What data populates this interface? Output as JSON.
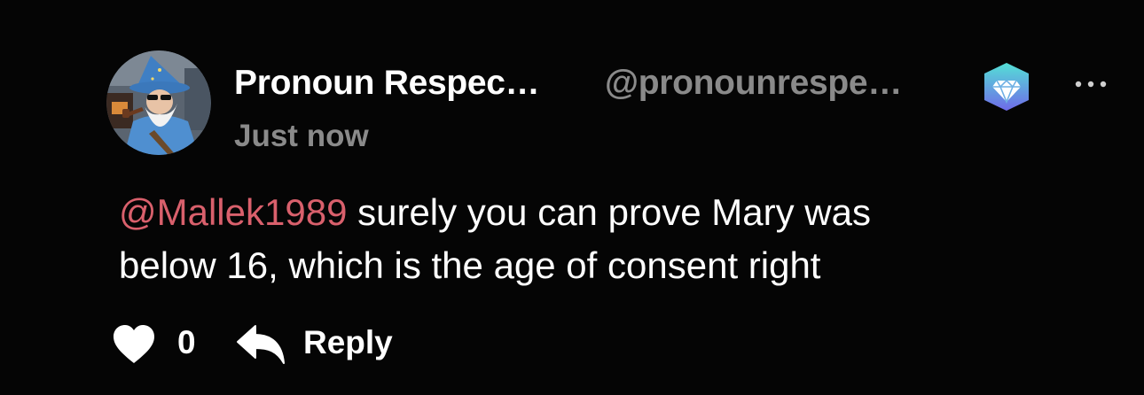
{
  "comment": {
    "author": {
      "display_name": "Pronoun Respec…",
      "handle": "@pronounrespe…",
      "avatar_icon": "wizard-avatar",
      "badge_icon": "diamond-badge-icon"
    },
    "timestamp": "Just now",
    "mention": "@Mallek1989",
    "text_line1_rest": " surely you can prove Mary was",
    "text_line2": "below 16, which is the age of consent right",
    "likes": "0",
    "reply_label": "Reply",
    "more_icon": "more-options-icon"
  },
  "colors": {
    "background": "#050505",
    "primary_text": "#ffffff",
    "secondary_text": "#8a8a8a",
    "mention": "#d9606c",
    "badge_gradient_start": "#54e0d6",
    "badge_gradient_end": "#6f6ae8"
  }
}
